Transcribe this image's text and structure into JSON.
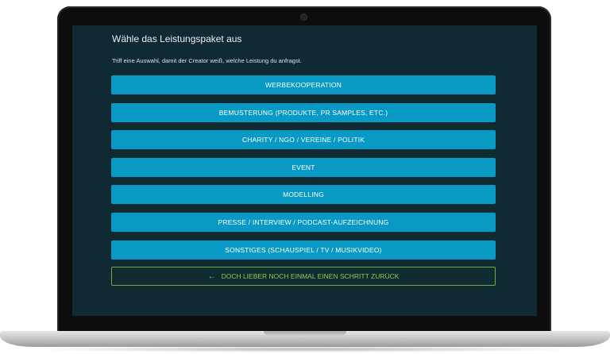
{
  "form": {
    "title": "Wähle das Leistungspaket aus",
    "subtitle": "Triff eine Auswahl, damit der Creator weiß, welche Leistung du anfragst.",
    "options": [
      {
        "label": "WERBEKOOPERATION"
      },
      {
        "label": "BEMUSTERUNG (PRODUKTE, PR SAMPLES, ETC.)"
      },
      {
        "label": "CHARITY / NGO / VEREINE / POLITIK"
      },
      {
        "label": "EVENT"
      },
      {
        "label": "MODELLING"
      },
      {
        "label": "PRESSE / INTERVIEW / PODCAST-AUFZEICHNUNG"
      },
      {
        "label": "SONSTIGES (SCHAUSPIEL / TV / MUSIKVIDEO)"
      }
    ],
    "back_label": "DOCH LIEBER NOCH EINMAL EINEN SCHRITT ZURÜCK",
    "back_icon": "arrow-left-icon"
  },
  "colors": {
    "screen_bg": "#102a34",
    "option_bg": "#0899c4",
    "back_accent": "#8ccf44"
  }
}
